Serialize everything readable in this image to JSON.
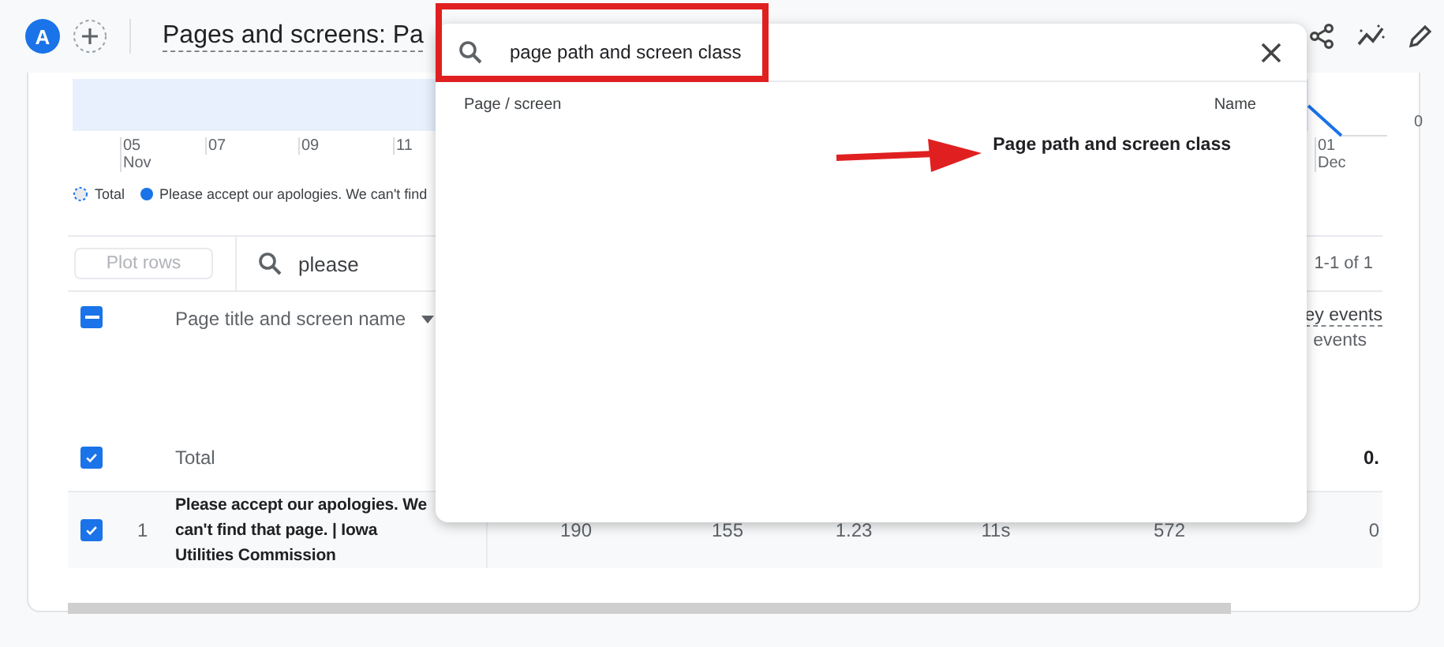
{
  "header": {
    "avatar": "A",
    "title": "Pages and screens: Pa"
  },
  "chart": {
    "x_labels": [
      {
        "day": "05",
        "month": "Nov"
      },
      {
        "day": "07"
      },
      {
        "day": "09"
      },
      {
        "day": "11"
      },
      {
        "day": "01",
        "month": "Dec"
      }
    ],
    "y_label": "0"
  },
  "legend": [
    {
      "kind": "total",
      "label": "Total"
    },
    {
      "kind": "series",
      "label": "Please accept our apologies. We can't find",
      "color": "#1a73e8"
    }
  ],
  "toolbar": {
    "plot_rows": {
      "label": "Plot rows",
      "disabled": true
    },
    "search": "please",
    "pagination": "1-1 of 1"
  },
  "table": {
    "select_all": {
      "indeterminate": true
    },
    "dimension": "Page title and screen name",
    "metric_header": "ey events",
    "metric_subheader": "events",
    "rows": [
      {
        "kind": "total",
        "checked": true,
        "label": "Total",
        "values": [
          "0."
        ]
      },
      {
        "kind": "item",
        "checked": true,
        "index": "1",
        "label": "Please accept our apologies. We can't find that page. | Iowa Utilities Commission",
        "values": [
          "190",
          "155",
          "1.23",
          "11s",
          "572",
          "0"
        ]
      }
    ]
  },
  "dialog": {
    "search": "page path and screen class",
    "columns": [
      "Page / screen",
      "Name"
    ],
    "items": [
      {
        "label": "Page path and screen class"
      }
    ]
  }
}
